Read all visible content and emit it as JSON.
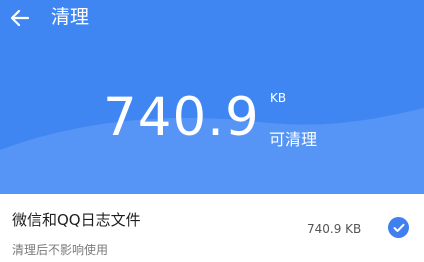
{
  "header": {
    "title": "清理",
    "size_value": "740.9",
    "size_unit": "KB",
    "cleanable_label": "可清理"
  },
  "items": [
    {
      "title": "微信和QQ日志文件",
      "subtitle": "清理后不影响使用",
      "size": "740.9 KB",
      "checked": true
    }
  ],
  "colors": {
    "header_bg": "#3f86f3",
    "header_wave": "#5a97f5",
    "check_blue": "#3f7ff0"
  },
  "icons": {
    "back": "arrow-left-icon",
    "check": "check-circle-icon"
  }
}
